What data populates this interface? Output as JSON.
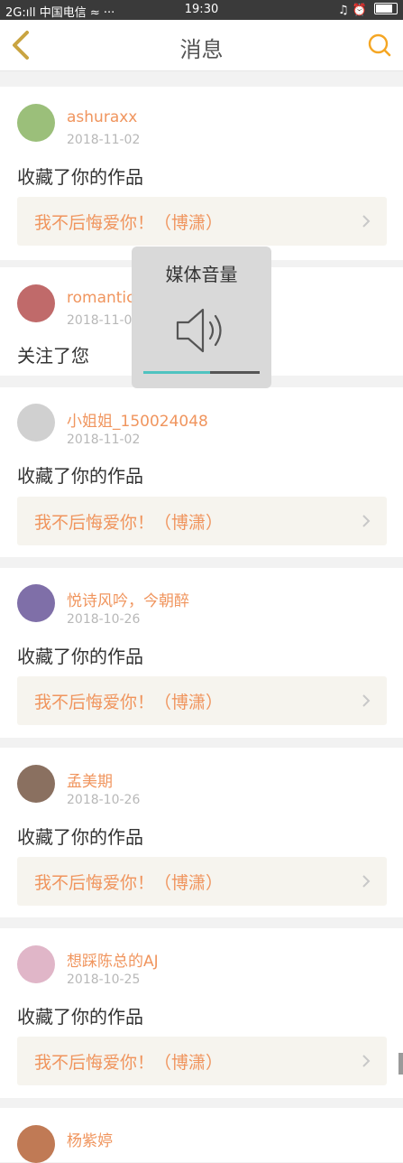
{
  "status_bar": {
    "left": "2G:ıll 中国电信 ≈ ···",
    "time": "19:30",
    "right": "♫ ⏰"
  },
  "nav": {
    "title": "消息",
    "colors": {
      "accent": "#f5a623",
      "back": "#c9a441"
    }
  },
  "notifications": [
    {
      "user": "ashuraxx",
      "date": "2018-11-02",
      "action": "收藏了你的作品",
      "work": "我不后悔爱你！（博潇）",
      "avatar_color": "#9bbf7a"
    },
    {
      "user": "romantic",
      "date": "2018-11-0",
      "action": "关注了您",
      "work": "",
      "avatar_color": "#c06a6a"
    },
    {
      "user": "小姐姐_150024048",
      "date": "2018-11-02",
      "action": "收藏了你的作品",
      "work": "我不后悔爱你！（博潇）",
      "avatar_color": "#d0d0d0"
    },
    {
      "user": "悦诗风吟，今朝醉",
      "date": "2018-10-26",
      "action": "收藏了你的作品",
      "work": "我不后悔爱你！（博潇）",
      "avatar_color": "#7f6fa8"
    },
    {
      "user": "孟美期",
      "date": "2018-10-26",
      "action": "收藏了你的作品",
      "work": "我不后悔爱你！（博潇）",
      "avatar_color": "#8a7060"
    },
    {
      "user": "想踩陈总的AJ",
      "date": "2018-10-25",
      "action": "收藏了你的作品",
      "work": "我不后悔爱你！（博潇）",
      "avatar_color": "#e0b6c8"
    },
    {
      "user": "杨紫婷",
      "date": "",
      "action": "",
      "work": "",
      "avatar_color": "#c07a55"
    }
  ],
  "volume_overlay": {
    "title": "媒体音量",
    "level": 0.57,
    "colors": {
      "fill": "#4fc3c0",
      "track": "#555555"
    }
  }
}
